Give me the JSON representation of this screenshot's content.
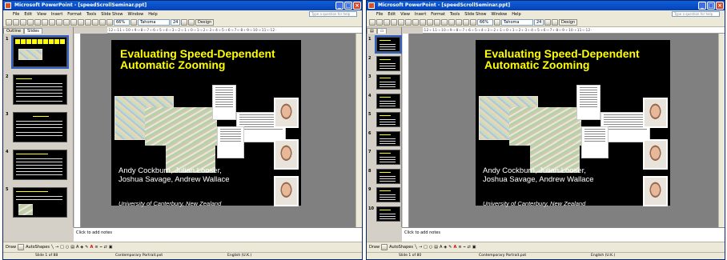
{
  "window_title": "Microsoft PowerPoint - [speedScrollSeminar.ppt]",
  "menu": [
    "File",
    "Edit",
    "View",
    "Insert",
    "Format",
    "Tools",
    "Slide Show",
    "Window",
    "Help"
  ],
  "help_placeholder": "Type a question for help",
  "zoom": "66%",
  "font_name": "Tahoma",
  "font_size": "24",
  "design_label": "Design",
  "ruler_text": "·12·ı·11·ı·10·ı·9·ı·8·ı·7·ı·6·ı·5·ı·4·ı·3·ı·2·ı·1·ı·0·ı·1·ı·2·ı·3·ı·4·ı·5·ı·6·ı·7·ı·8·ı·9·ı·10·ı·11·ı·12·",
  "tabs": [
    "Outline",
    "Slides"
  ],
  "left_thumbs": [
    {
      "num": "1",
      "title": "Evaluating Speed-Dependent Automatic Zooming"
    },
    {
      "num": "2",
      "title": "Road Map"
    },
    {
      "num": "3",
      "title": "Scrolling"
    },
    {
      "num": "4",
      "title": "Document Navigation Tasks"
    },
    {
      "num": "5",
      "title": "Document Navigation Tasks"
    }
  ],
  "right_thumb_numbers": [
    "1",
    "2",
    "3",
    "4",
    "5",
    "6",
    "7",
    "8",
    "9",
    "10"
  ],
  "slide": {
    "title": "Evaluating Speed-Dependent\nAutomatic Zooming",
    "authors": "Andy Cockburn, Julian Looser,\nJoshua Savage, Andrew Wallace",
    "affiliation": "University of Canterbury, New Zealand"
  },
  "notes_placeholder": "Click to add notes",
  "draw_label": "Draw",
  "autoshapes_label": "AutoShapes",
  "status": {
    "slide_left": "Slide 1 of 88",
    "slide_right": "Slide 1 of 80",
    "design": "Contemporary Portrait.pot",
    "language": "English (U.K.)"
  }
}
